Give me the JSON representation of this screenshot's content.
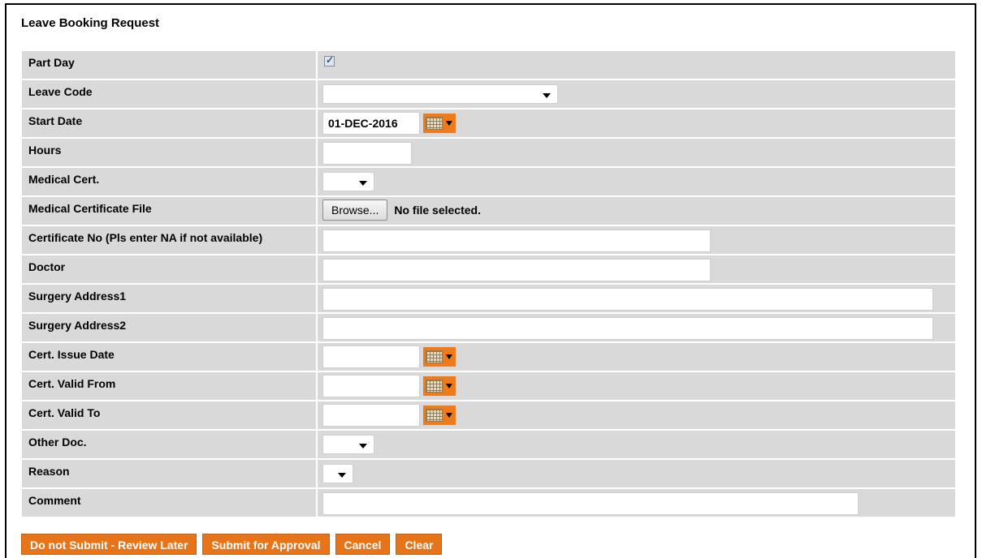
{
  "form": {
    "title": "Leave Booking Request",
    "labels": {
      "part_day": "Part Day",
      "leave_code": "Leave Code",
      "start_date": "Start Date",
      "hours": "Hours",
      "medical_cert": "Medical Cert.",
      "medical_cert_file": "Medical Certificate File",
      "certificate_no": "Certificate No (Pls enter NA if not available)",
      "doctor": "Doctor",
      "surgery_address1": "Surgery Address1",
      "surgery_address2": "Surgery Address2",
      "cert_issue_date": "Cert. Issue Date",
      "cert_valid_from": "Cert. Valid From",
      "cert_valid_to": "Cert. Valid To",
      "other_doc": "Other Doc.",
      "reason": "Reason",
      "comment": "Comment"
    },
    "values": {
      "part_day_checked": true,
      "checkmark": "✓",
      "leave_code": "",
      "start_date": "01-DEC-2016",
      "hours": "",
      "medical_cert": "",
      "certificate_no": "",
      "doctor": "",
      "surgery_address1": "",
      "surgery_address2": "",
      "cert_issue_date": "",
      "cert_valid_from": "",
      "cert_valid_to": "",
      "other_doc": "",
      "reason": "",
      "comment": ""
    },
    "file": {
      "browse_label": "Browse...",
      "status": "No file selected."
    }
  },
  "actions": {
    "review_later": "Do not Submit - Review Later",
    "submit": "Submit for Approval",
    "cancel": "Cancel",
    "clear": "Clear"
  },
  "colors": {
    "accent": "#e8741a",
    "row_bg": "#d9d9d9"
  },
  "icons": {
    "calendar": "calendar-icon",
    "dropdown": "chevron-down-icon",
    "checkbox": "check-icon"
  }
}
